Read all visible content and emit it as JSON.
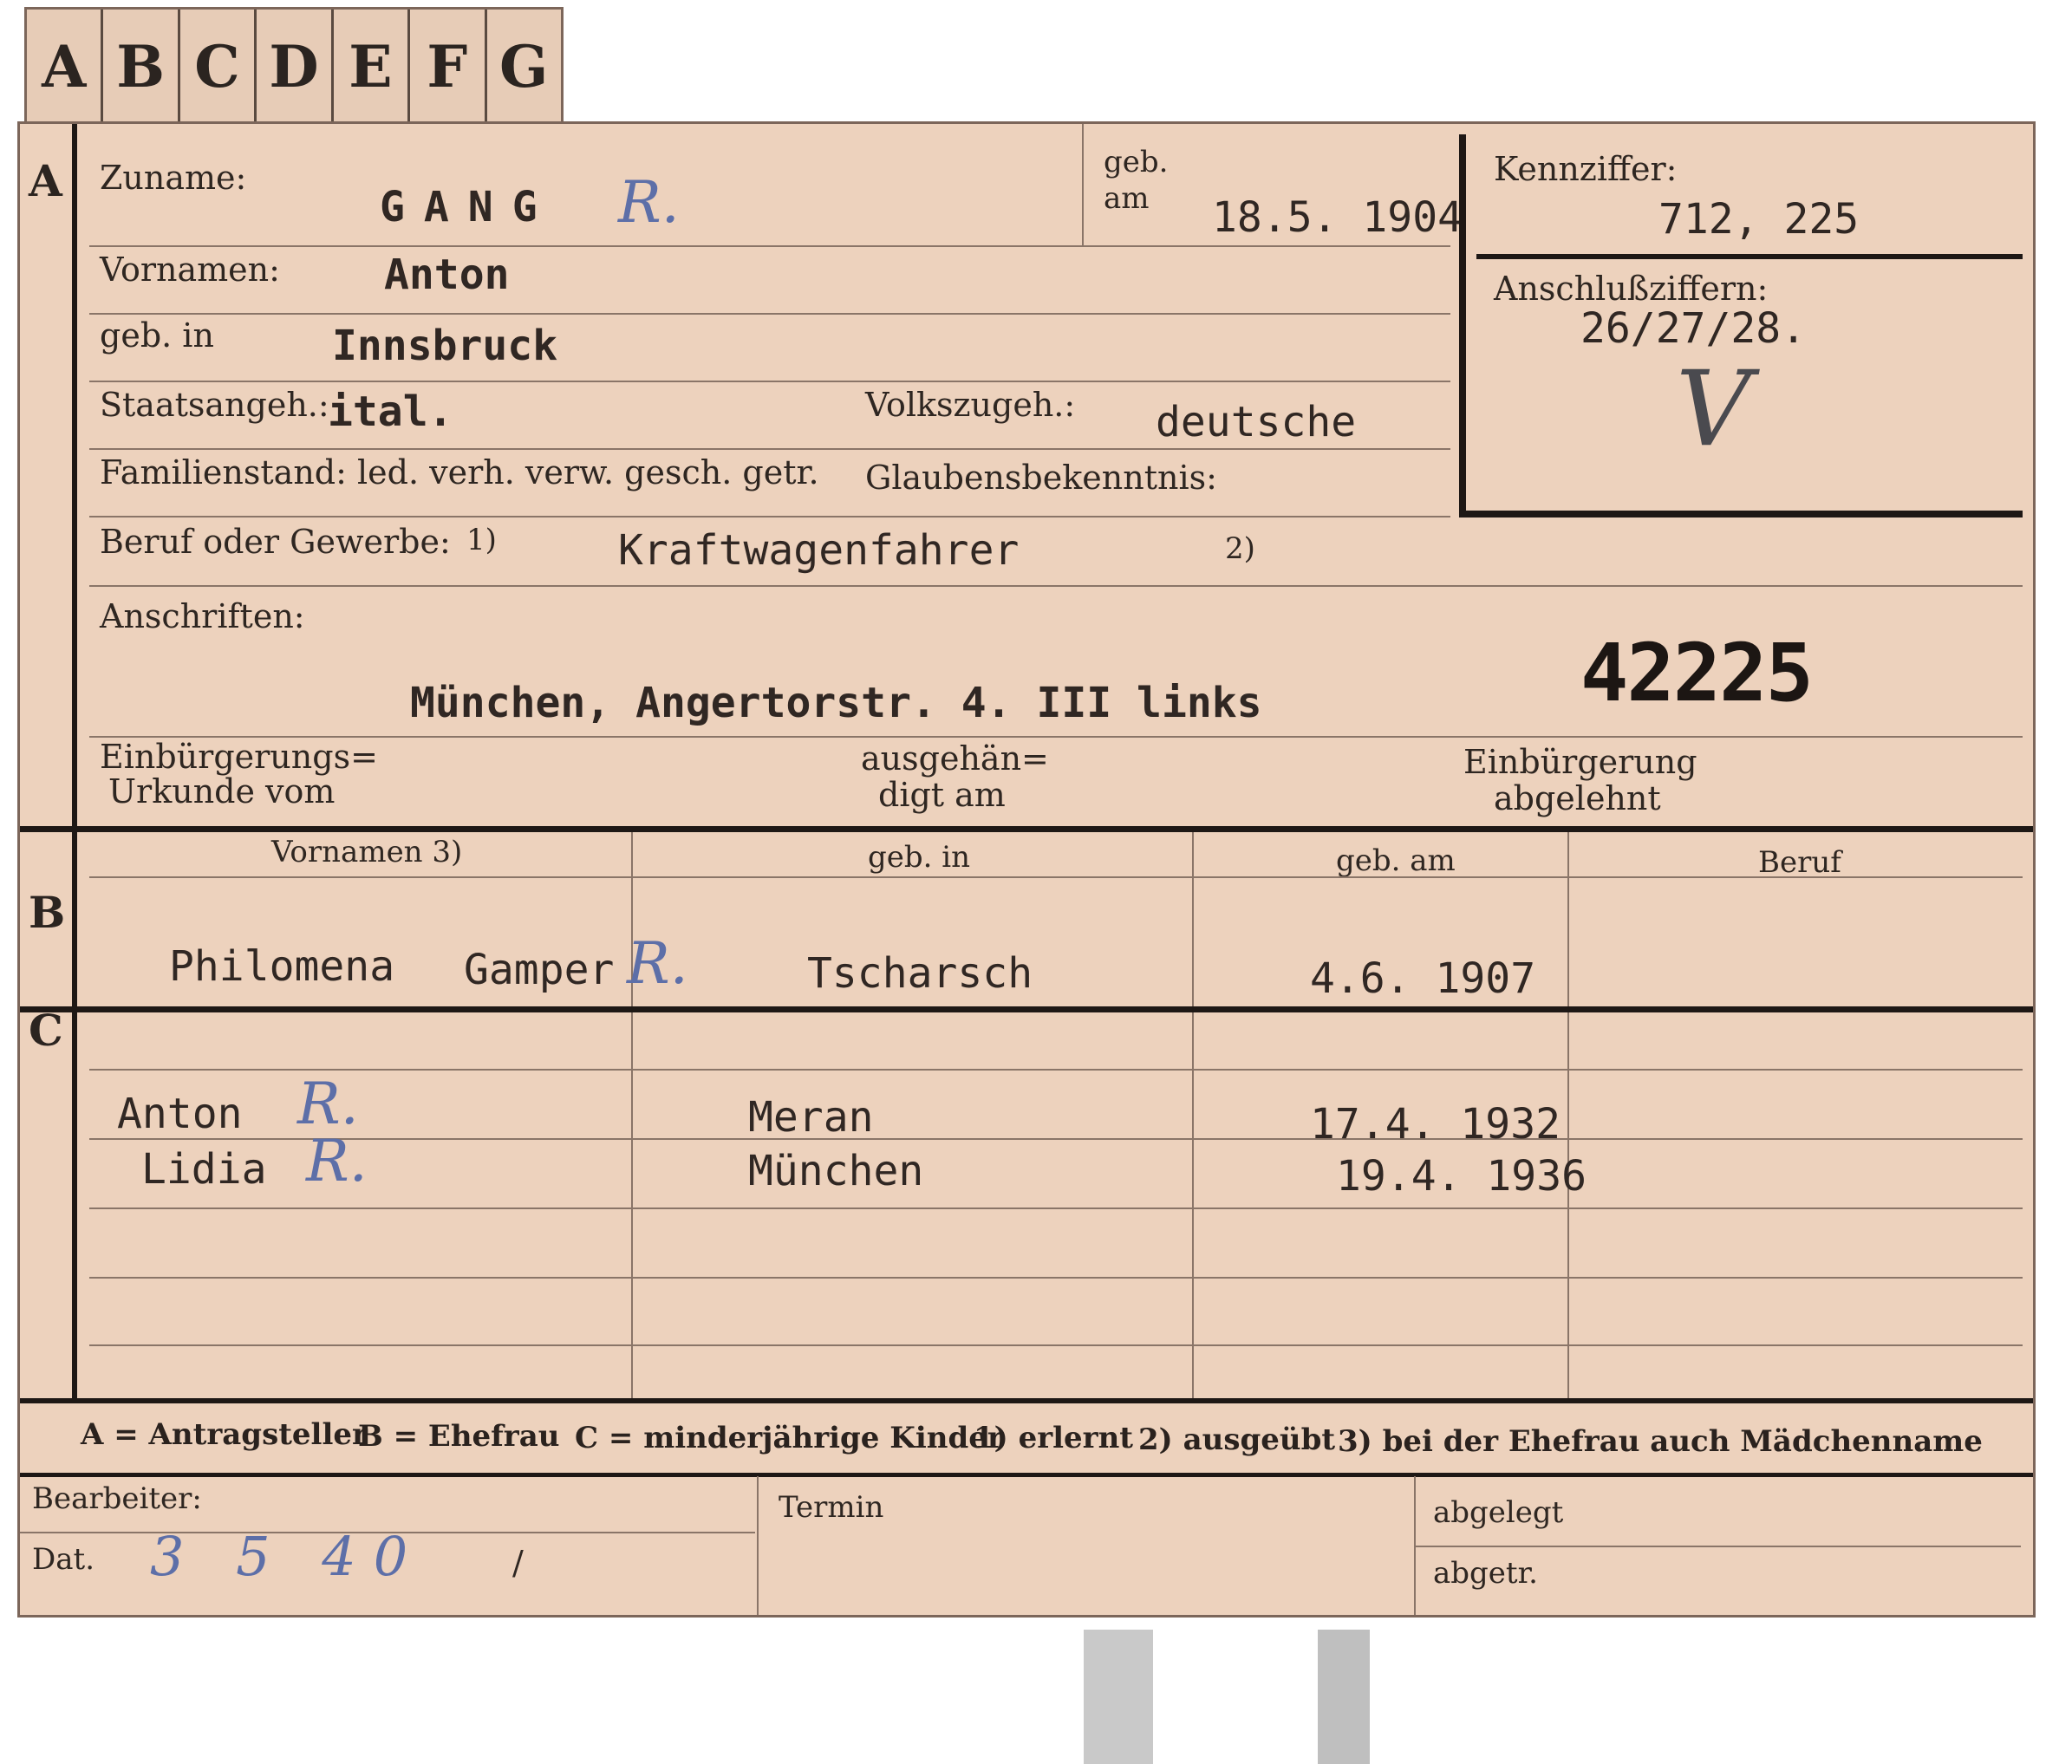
{
  "tabs": [
    "A",
    "B",
    "C",
    "D",
    "E",
    "F",
    "G"
  ],
  "sections": {
    "a": "A",
    "b": "B",
    "c": "C"
  },
  "applicant": {
    "zuname_label": "Zuname:",
    "zuname_value": "GANG",
    "mark": "R.",
    "geb_am_label_1": "geb.",
    "geb_am_label_2": "am",
    "geb_am_value": "18.5. 1904",
    "vornamen_label": "Vornamen:",
    "vornamen_value": "Anton",
    "geb_in_label": "geb. in",
    "geb_in_value": "Innsbruck",
    "staatsangeh_label": "Staatsangeh.:",
    "staatsangeh_value": "ital.",
    "volkszugeh_label": "Volkszugeh.:",
    "volkszugeh_value": "deutsche",
    "familienstand_label": "Familienstand: led. verh. verw. gesch. getr.",
    "glaubens_label": "Glaubensbekenntnis:",
    "beruf_label": "Beruf oder Gewerbe:",
    "beruf_fn1": "1)",
    "beruf_value": "Kraftwagenfahrer",
    "beruf_fn2": "2)",
    "anschriften_label": "Anschriften:",
    "anschrift_value": "München, Angertorstr. 4. III links",
    "stamp_number": "42225",
    "einb_urkunde_label_1": "Einbürgerungs=",
    "einb_urkunde_label_2": "Urkunde vom",
    "ausgehaendigt_label_1": "ausgehän=",
    "ausgehaendigt_label_2": "digt am",
    "einb_abgelehnt_label_1": "Einbürgerung",
    "einb_abgelehnt_label_2": "abgelehnt"
  },
  "kennziffer": {
    "label": "Kennziffer:",
    "value": "712, 225",
    "anschluss_label": "Anschlußziffern:",
    "anschluss_value": "26/27/28.",
    "check_mark": "V"
  },
  "spouse": {
    "columns": [
      "Vornamen 3)",
      "geb. in",
      "geb. am",
      "Beruf"
    ],
    "name": "Philomena",
    "maiden_name": "Gamper",
    "mark": "R.",
    "birthplace": "Tscharsch",
    "birthdate": "4.6. 1907"
  },
  "children": [
    {
      "name": "Anton",
      "mark": "R.",
      "birthplace": "Meran",
      "birthdate": "17.4. 1932"
    },
    {
      "name": "Lidia",
      "mark": "R.",
      "birthplace": "München",
      "birthdate": "19.4. 1936"
    }
  ],
  "legend": {
    "a": "A = Antragsteller",
    "b": "B = Ehefrau",
    "c": "C = minderjährige Kinder",
    "n1": "1) erlernt",
    "n2": "2) ausgeübt",
    "n3": "3) bei der Ehefrau auch Mädchenname"
  },
  "footer": {
    "bearbeiter_label": "Bearbeiter:",
    "dat_label": "Dat.",
    "dat_value": "3 5 40",
    "dat_tick": "/",
    "termin_label": "Termin",
    "abgelegt_label": "abgelegt",
    "abgetr_label": "abgetr."
  }
}
